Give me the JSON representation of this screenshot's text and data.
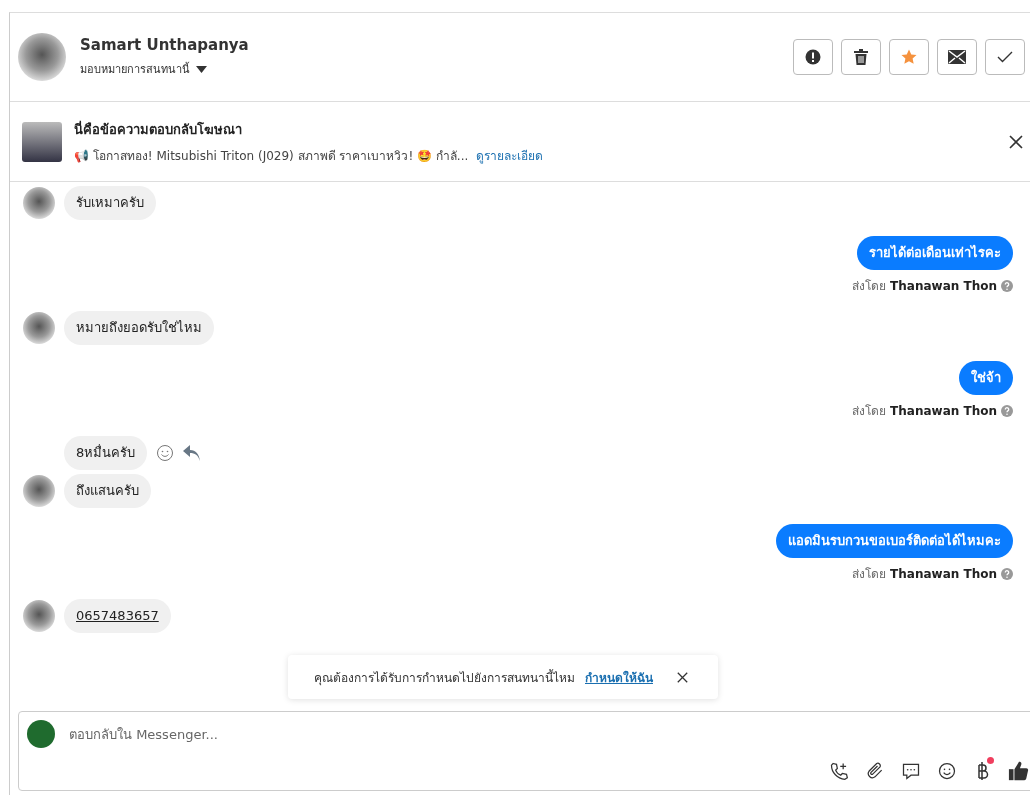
{
  "header": {
    "name": "Samart Unthapanya",
    "assign_label": "มอบหมายการสนทนานี้",
    "starred": true,
    "actions": [
      {
        "kind": "alert"
      },
      {
        "kind": "trash"
      },
      {
        "kind": "star"
      },
      {
        "kind": "mail"
      },
      {
        "kind": "check"
      }
    ]
  },
  "ad_reply": {
    "title": "นี่คือข้อความตอบกลับโฆษณา",
    "snippet": "📢 โอกาสทอง! Mitsubishi Triton (J029) สภาพดี ราคาเบาหวิว! 🤩 กำลั...",
    "link": "ดูรายละเอียด"
  },
  "messages": [
    {
      "kind": "in",
      "text": "รับเหมาครับ",
      "avatar": true,
      "actions": false
    },
    {
      "kind": "out",
      "text": "รายได้ต่อเดือนเท่าไรคะ",
      "sender_prefix": "ส่งโดย",
      "sender": "Thanawan Thon"
    },
    {
      "kind": "in",
      "text": "หมายถึงยอดรับใช่ไหม",
      "avatar": true,
      "actions": false
    },
    {
      "kind": "out",
      "text": "ใช่จ้า",
      "sender_prefix": "ส่งโดย",
      "sender": "Thanawan Thon"
    },
    {
      "kind": "in",
      "text": "8หมื่นครับ",
      "avatar": false,
      "actions": true
    },
    {
      "kind": "in",
      "text": "ถึงแสนครับ",
      "avatar": true,
      "actions": false
    },
    {
      "kind": "out",
      "text": "แอดมินรบกวนขอเบอร์ติดต่อได้ไหมคะ",
      "sender_prefix": "ส่งโดย",
      "sender": "Thanawan Thon"
    },
    {
      "kind": "phone",
      "text": "0657483657",
      "avatar": true,
      "actions": false
    }
  ],
  "toast": {
    "text": "คุณต้องการได้รับการกำหนดไปยังการสนทนานี้ไหม",
    "link": "กำหนดให้ฉัน"
  },
  "composer": {
    "placeholder": "ตอบกลับใน Messenger...",
    "tools": [
      {
        "kind": "call",
        "badge": false
      },
      {
        "kind": "attach",
        "badge": false
      },
      {
        "kind": "chat",
        "badge": false
      },
      {
        "kind": "emoji",
        "badge": false
      },
      {
        "kind": "baht",
        "badge": true
      },
      {
        "kind": "like",
        "badge": false
      }
    ]
  }
}
